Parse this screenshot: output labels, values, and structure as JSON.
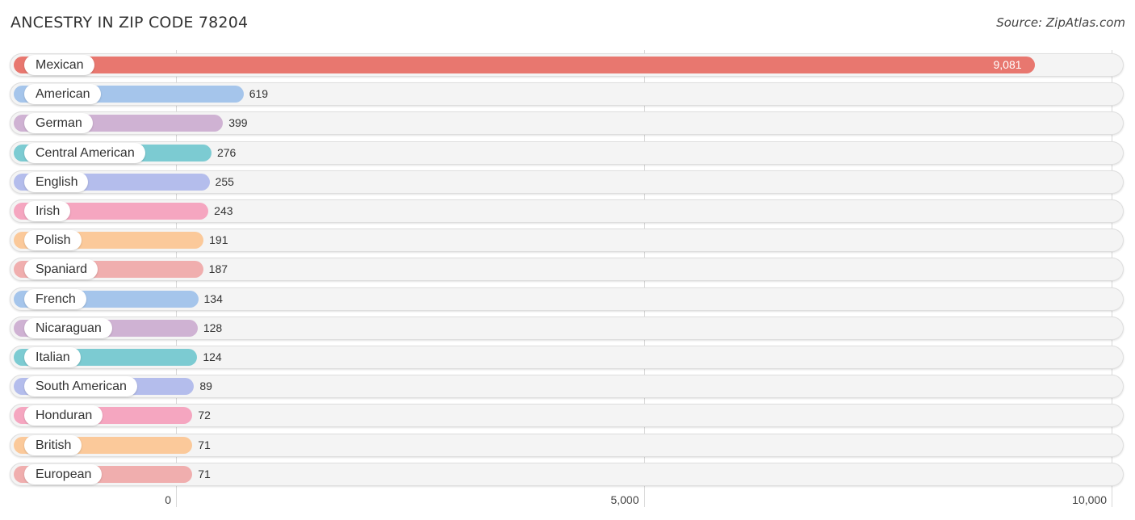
{
  "header": {
    "title": "ANCESTRY IN ZIP CODE 78204",
    "source": "Source: ZipAtlas.com"
  },
  "chart_data": {
    "type": "bar",
    "orientation": "horizontal",
    "title": "ANCESTRY IN ZIP CODE 78204",
    "xlabel": "",
    "ylabel": "",
    "xlim": [
      0,
      10000
    ],
    "x_ticks": [
      0,
      5000,
      10000
    ],
    "x_tick_labels": [
      "0",
      "5,000",
      "10,000"
    ],
    "grid": true,
    "categories": [
      "Mexican",
      "American",
      "German",
      "Central American",
      "English",
      "Irish",
      "Polish",
      "Spaniard",
      "French",
      "Nicaraguan",
      "Italian",
      "South American",
      "Honduran",
      "British",
      "European"
    ],
    "values": [
      9081,
      619,
      399,
      276,
      255,
      243,
      191,
      187,
      134,
      128,
      124,
      89,
      72,
      71,
      71
    ],
    "value_labels": [
      "9,081",
      "619",
      "399",
      "276",
      "255",
      "243",
      "191",
      "187",
      "134",
      "128",
      "124",
      "89",
      "72",
      "71",
      "71"
    ],
    "colors": [
      "#e8776f",
      "#a5c5eb",
      "#cfb2d3",
      "#7ccbd2",
      "#b4bdec",
      "#f5a6c0",
      "#fbc99a",
      "#f0aeae",
      "#a5c5eb",
      "#cfb2d3",
      "#7ccbd2",
      "#b4bdec",
      "#f5a6c0",
      "#fbc99a",
      "#f0aeae"
    ]
  }
}
